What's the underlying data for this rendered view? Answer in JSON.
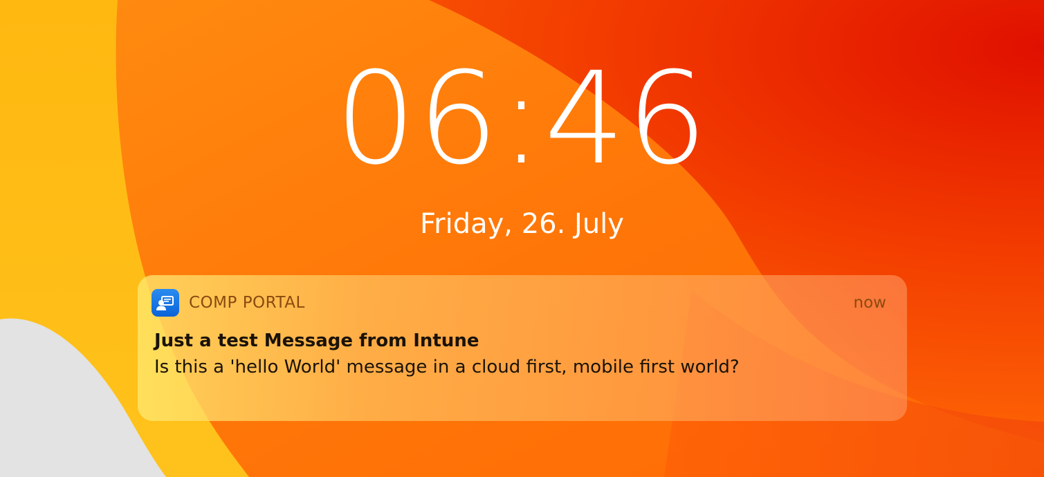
{
  "lockscreen": {
    "time": "06:46",
    "date": "Friday, 26. July"
  },
  "notification": {
    "app_icon": "company-portal-icon",
    "app_name": "COMP PORTAL",
    "time": "now",
    "title": "Just a test Message from Intune",
    "body": "Is this a 'hello World' message in a cloud first, mobile first world?"
  },
  "colors": {
    "wallpaper_orange": "#ff7a0a",
    "wallpaper_red": "#e51e00",
    "wallpaper_yellow": "#ffb814",
    "wallpaper_grey": "#e2e2e2",
    "app_icon_blue": "#0a63d8"
  }
}
